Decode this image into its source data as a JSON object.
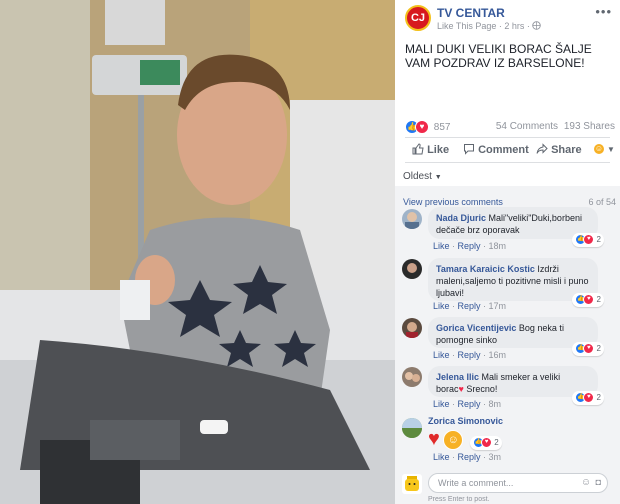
{
  "page": {
    "name": "TV CENTAR",
    "meta": "Like This Page · 2 hrs · ",
    "logo_text": "CJ"
  },
  "post": {
    "text": "MALI DUKI VELIKI BORAC ŠALJE VAM POZDRAV IZ BARSELONE!"
  },
  "stats": {
    "reactions": "857",
    "comments": "54 Comments",
    "shares": "193 Shares"
  },
  "actions": {
    "like": "Like",
    "comment": "Comment",
    "share": "Share"
  },
  "sort": "Oldest",
  "view_previous": "View previous comments",
  "comment_count": "6 of 54",
  "footer_labels": {
    "like": "Like",
    "reply": "Reply"
  },
  "comments": [
    {
      "name": "Nada Djuric",
      "text": "Mali\"veliki\"Duki,borbeni dečače brz oporavak",
      "time": "18m",
      "reactions": "2"
    },
    {
      "name": "Tamara Karaicic Kostic",
      "text": "Izdrži maleni,saljemo ti pozitivne misli i puno ljubavi!",
      "time": "17m",
      "reactions": "2"
    },
    {
      "name": "Gorica Vicentijevic",
      "text": "Bog neka ti pomogne sinko",
      "time": "16m",
      "reactions": "2"
    },
    {
      "name": "Jelena Ilic",
      "text": "Mali smeker a veliki borac",
      "text2": "Srecno!",
      "time": "8m",
      "reactions": "2"
    },
    {
      "name": "Zorica Simonovic",
      "time": "3m",
      "reactions": "2"
    }
  ],
  "write": {
    "placeholder": "Write a comment...",
    "hint": "Press Enter to post."
  },
  "colors": {
    "link": "#365899",
    "like": "#2078f4",
    "love": "#f0284a",
    "haha": "#f7b125"
  }
}
